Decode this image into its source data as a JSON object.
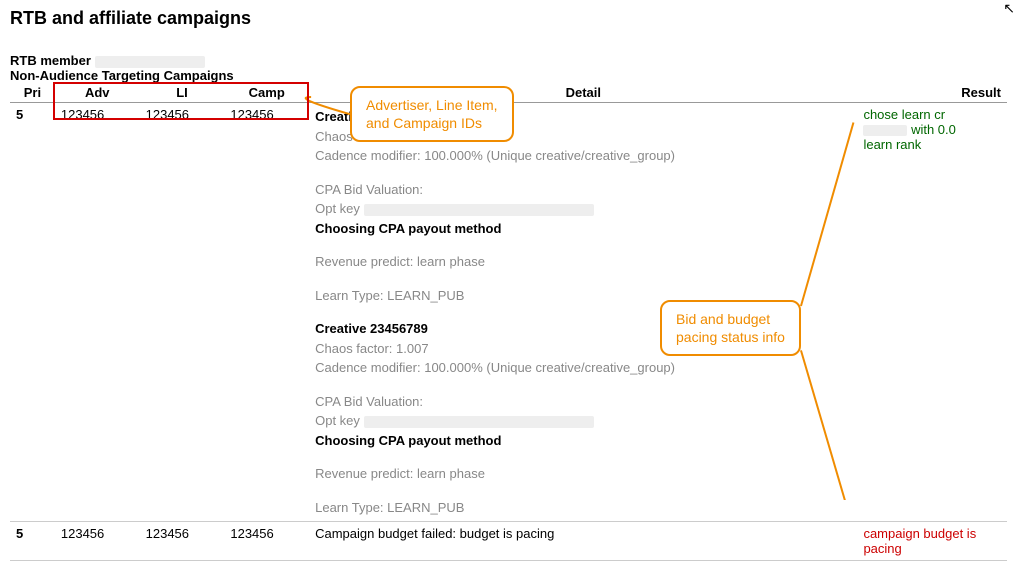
{
  "page_title": "RTB and affiliate campaigns",
  "member_line": "RTB member",
  "section_title": "Non-Audience Targeting Campaigns",
  "columns": {
    "pri": "Pri",
    "adv": "Adv",
    "li": "LI",
    "camp": "Camp",
    "detail": "Detail",
    "result": "Result"
  },
  "rows": [
    {
      "pri": "5",
      "adv": "123456",
      "li": "123456",
      "camp": "123456",
      "creatives": [
        {
          "title": "Creative 12345678",
          "chaos": "Chaos factor: 0.998",
          "cadence": "Cadence modifier: 100.000% (Unique creative/creative_group)",
          "cpa_hdr": "CPA Bid Valuation:",
          "opt_key": "Opt key",
          "choosing": "Choosing CPA payout method",
          "revenue": "Revenue predict: learn phase",
          "learn": "Learn Type: LEARN_PUB"
        },
        {
          "title": "Creative 23456789",
          "chaos": "Chaos factor: 1.007",
          "cadence": "Cadence modifier: 100.000% (Unique creative/creative_group)",
          "cpa_hdr": "CPA Bid Valuation:",
          "opt_key": "Opt key",
          "choosing": "Choosing CPA payout method",
          "revenue": "Revenue predict: learn phase",
          "learn": "Learn Type: LEARN_PUB"
        }
      ],
      "result": {
        "line1": "chose learn cr",
        "line2_suffix": " with 0.0",
        "line3": "learn rank",
        "color": "green"
      }
    },
    {
      "pri": "5",
      "adv": "123456",
      "li": "123456",
      "camp": "123456",
      "detail_text": "Campaign budget failed: budget is pacing",
      "result": {
        "line1": "campaign budget is",
        "line2": "pacing",
        "color": "red"
      }
    }
  ],
  "callouts": {
    "ids": "Advertiser, Line Item,\nand Campaign IDs",
    "pacing": "Bid and budget\npacing status info"
  }
}
